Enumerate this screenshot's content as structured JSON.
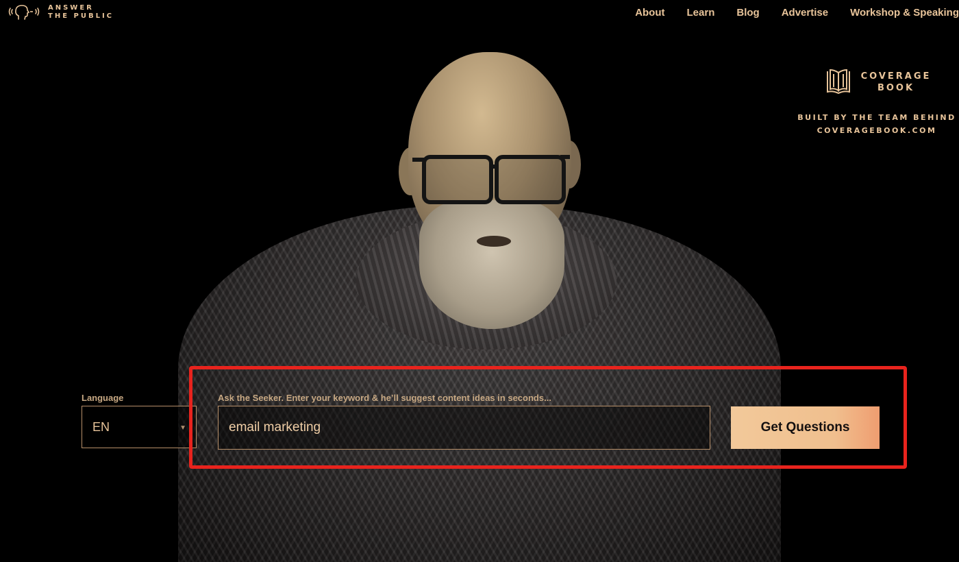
{
  "brand": {
    "line1": "ANSWER",
    "line2": "THE PUBLIC",
    "icon": "speaking-head-icon",
    "accent": "#e8c49a"
  },
  "nav": {
    "items": [
      {
        "label": "About"
      },
      {
        "label": "Learn"
      },
      {
        "label": "Blog"
      },
      {
        "label": "Advertise"
      },
      {
        "label": "Workshop & Speaking"
      }
    ]
  },
  "coveragebook": {
    "name_line1": "COVERAGE",
    "name_line2": "BOOK",
    "tagline_line1": "BUILT BY THE TEAM BEHIND",
    "tagline_line2": "COVERAGEBOOK.COM",
    "icon": "open-book-icon"
  },
  "search": {
    "language_label": "Language",
    "language_value": "EN",
    "keyword_label": "Ask the Seeker. Enter your keyword & he’ll suggest content ideas in seconds...",
    "keyword_value": "email marketing",
    "submit_label": "Get Questions",
    "button_color": "#f0c494",
    "highlight_color": "#e8231d"
  }
}
